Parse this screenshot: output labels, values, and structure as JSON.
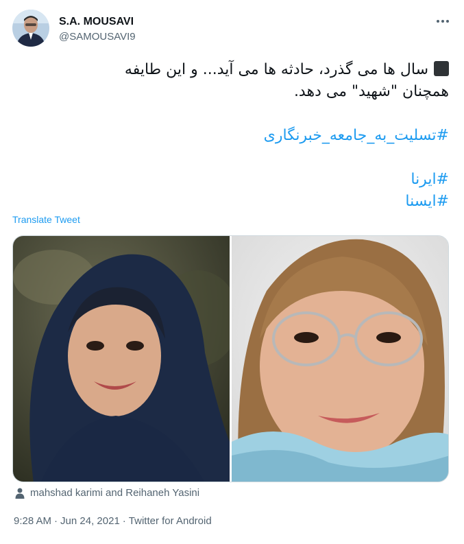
{
  "author": {
    "display_name": "S.A. MOUSAVI",
    "handle": "@SAMOUSAVI9"
  },
  "tweet": {
    "line1": "سال ها می گذرد، حادثه ها می آید... و این طایفه",
    "line2": "همچنان \"شهید\" می دهد.",
    "hashtags": [
      "#تسلیت_به_جامعه_خبرنگاری",
      "#ایرنا",
      "#ایسنا"
    ],
    "translate_label": "Translate Tweet"
  },
  "media": {
    "tagged_people": "mahshad karimi and Reihaneh Yasini"
  },
  "meta": {
    "time": "9:28 AM",
    "date": "Jun 24, 2021",
    "source": "Twitter for Android",
    "separator": "·"
  },
  "icons": {
    "more": "more-horizontal-icon",
    "person": "person-icon",
    "square": "black-square-emoji"
  },
  "colors": {
    "link": "#1d9bf0",
    "secondary_text": "#536471",
    "primary_text": "#0f1419"
  }
}
